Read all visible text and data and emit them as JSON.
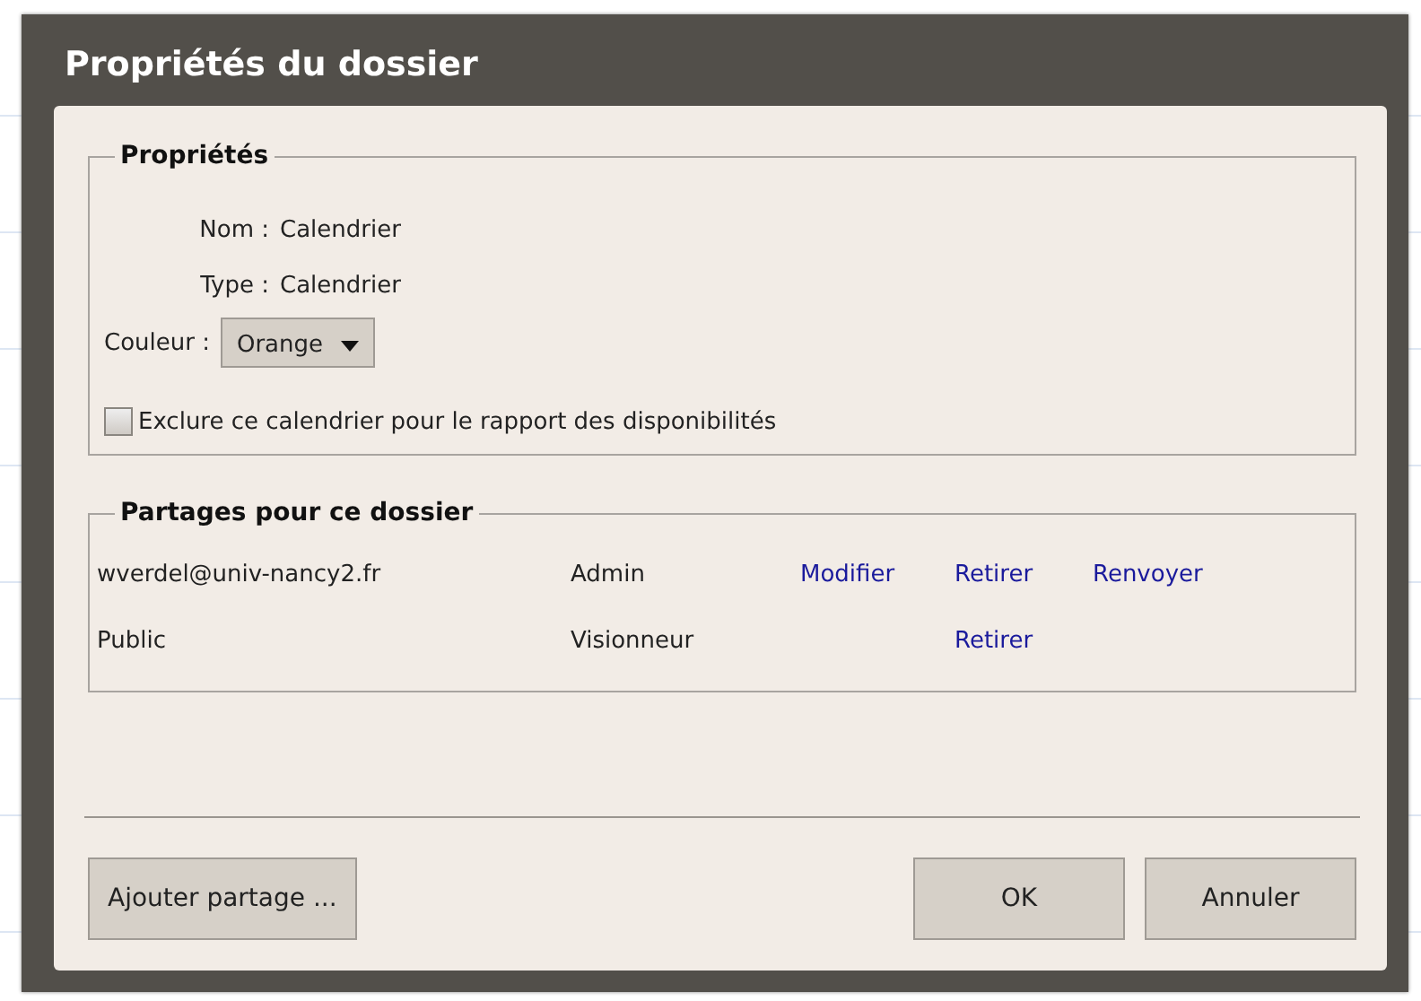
{
  "window": {
    "title": "Propriétés du dossier"
  },
  "properties": {
    "legend": "Propriétés",
    "fields": [
      {
        "label": "Nom :",
        "value": "Calendrier"
      },
      {
        "label": "Type :",
        "value": "Calendrier"
      }
    ],
    "color": {
      "label": "Couleur :",
      "value": "Orange"
    },
    "exclude": {
      "label": "Exclure ce calendrier pour le rapport des disponibilités",
      "checked": false
    }
  },
  "shares": {
    "legend": "Partages pour ce dossier",
    "rows": [
      {
        "grantee": "wverdel@univ-nancy2.fr",
        "role": "Admin",
        "modify": "Modifier",
        "remove": "Retirer",
        "resend": "Renvoyer"
      },
      {
        "grantee": "Public",
        "role": "Visionneur",
        "remove": "Retirer"
      }
    ]
  },
  "buttons": {
    "add": "Ajouter partage ...",
    "ok": "OK",
    "cancel": "Annuler"
  }
}
